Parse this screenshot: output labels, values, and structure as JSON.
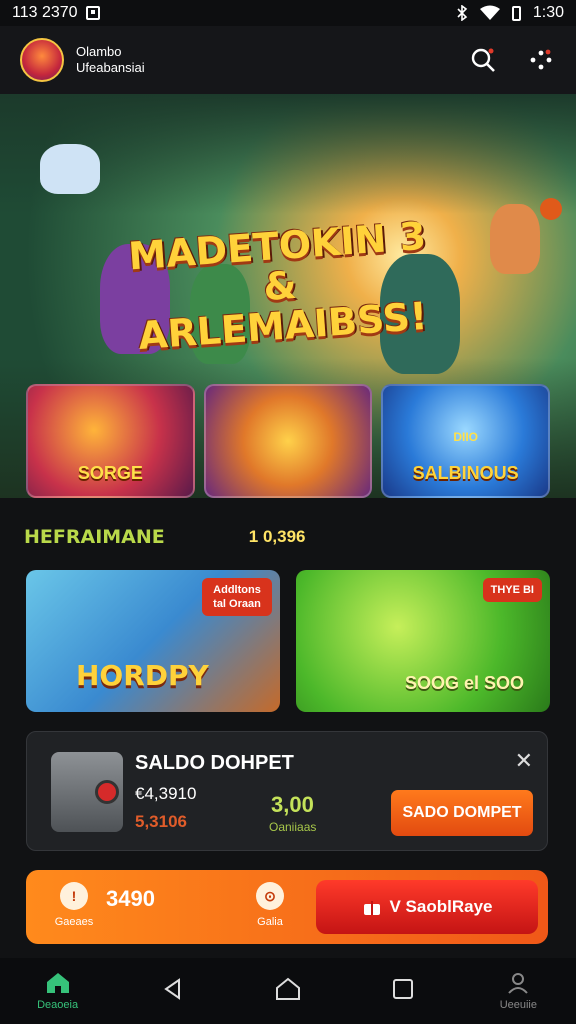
{
  "status": {
    "time_left": "113 2370",
    "time_right": "1:30"
  },
  "account": {
    "line1": "Olambo",
    "line2": "Ufeabansiai"
  },
  "hero": {
    "title_line1": "MADETOKIN 3",
    "title_line2": "& ARLEMAIBSS!"
  },
  "cards": [
    {
      "label": "SORGE"
    },
    {
      "label": ""
    },
    {
      "label": "SALBINOUS",
      "badge": "DIIO"
    }
  ],
  "section": {
    "title": "HEFRAIMANE",
    "count": "1 0,396"
  },
  "promos": [
    {
      "ribbon": "Addltons tal Oraan",
      "title": "HORDPY"
    },
    {
      "ribbon": "THYE BI",
      "title": "SOOG el SOO"
    }
  ],
  "panel": {
    "title": "SALDO DOHPET",
    "value1": "€4,3910",
    "value2": "5,3106",
    "amount": "3,00",
    "amount_sub": "Oaniiaas",
    "button": "SADO DOMPET",
    "close": "✕"
  },
  "cta": {
    "chip1_label": "Gaeaes",
    "amount": "3490",
    "chip2_label": "Galia",
    "button": "V SaoblRaye"
  },
  "nav": {
    "home": "Deaoeia",
    "profile": "Ueeuiie"
  },
  "colors": {
    "accent": "#f0681a",
    "active": "#36c27a",
    "gold": "#ffd23a"
  }
}
